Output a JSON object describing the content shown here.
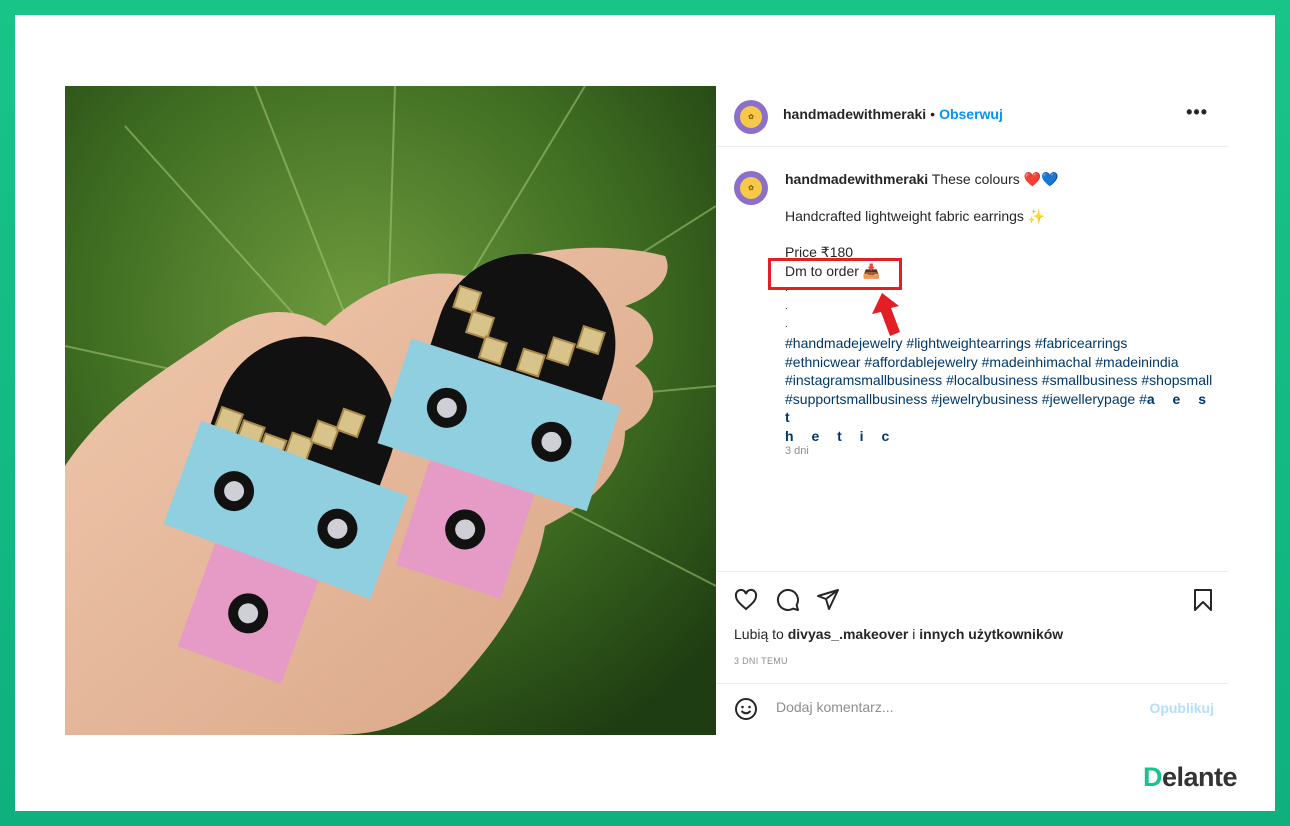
{
  "post": {
    "username": "handmadewithmeraki",
    "follow_label": "Obserwuj",
    "more_label": "•••",
    "caption": {
      "username": "handmadewithmeraki",
      "line1": "These colours ❤️💙",
      "line2": "Handcrafted lightweight fabric earrings ✨",
      "price": "Price ₹180",
      "dm": "Dm to order 📥",
      "dot1": ".",
      "dot2": ".",
      "dot3": ".",
      "hashtags_line1": "#handmadejewelry #lightweightearrings #fabricearrings",
      "hashtags_line2": "#ethnicwear #affordablejewelry #madeinhimachal #madeinindia",
      "hashtags_line3": "#instagramsmallbusiness #localbusiness #smallbusiness #shopsmall",
      "hashtags_line4": "#supportsmallbusiness #jewelrybusiness #jewellerypage #",
      "hashtags_spaced1": "a e s t",
      "hashtags_spaced2": "h e t i c"
    },
    "caption_time": "3 dni",
    "likes_prefix": "Lubią to",
    "likes_user": "divyas_.makeover",
    "likes_mid": "i",
    "likes_suffix": "innych użytkowników",
    "posted": "3 DNI TEMU",
    "comment_placeholder": "Dodaj komentarz...",
    "publish_label": "Opublikuj"
  },
  "brand": {
    "logo_d": "D",
    "logo_rest": "elante"
  },
  "colors": {
    "frame": "#19c489",
    "link": "#0095f6",
    "highlight": "#e31e24",
    "hashtag": "#00376b"
  },
  "icons": [
    "heart-icon",
    "comment-icon",
    "share-icon",
    "bookmark-icon",
    "emoji-icon",
    "arrow-icon"
  ]
}
